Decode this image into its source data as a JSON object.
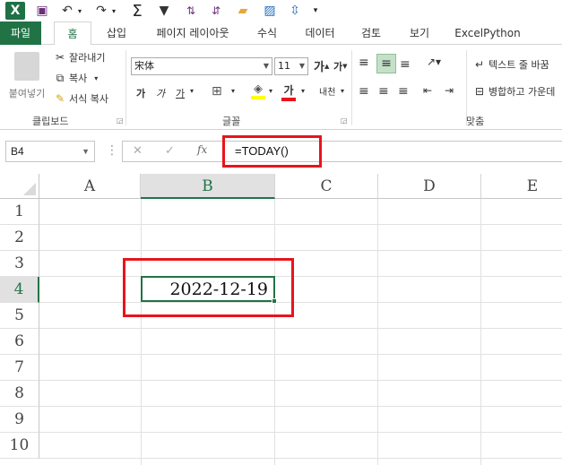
{
  "qat": {
    "logo": "X",
    "save_icon": "save-icon",
    "undo_icon": "undo-icon",
    "redo_icon": "redo-icon",
    "sum_icon": "autosum-icon",
    "filter_icon": "filter-icon",
    "sort_asc_icon": "sort-asc-icon",
    "sort_desc_icon": "sort-desc-icon",
    "folder_icon": "folder-icon",
    "more_icon": "customize-icon"
  },
  "tabs": [
    "파일",
    "홈",
    "삽입",
    "페이지 레이아웃",
    "수식",
    "데이터",
    "검토",
    "보기",
    "ExcelPython"
  ],
  "ribbon": {
    "clipboard": {
      "paste": "붙여넣기",
      "cut": "잘라내기",
      "copy": "복사",
      "format_painter": "서식 복사",
      "label": "클립보드"
    },
    "font": {
      "name": "宋体",
      "size": "11",
      "grow": "가",
      "shrink": "가",
      "bold": "가",
      "italic": "가",
      "underline": "가",
      "font_color": "가",
      "phonetic": "내천",
      "label": "글꼴"
    },
    "alignment": {
      "wrap_text": "텍스트 줄 바꿈",
      "merge_center": "병합하고 가운데",
      "label": "맞춤"
    }
  },
  "formula_bar": {
    "name_box": "B4",
    "cancel": "✕",
    "enter": "✓",
    "fx": "fx",
    "formula": "=TODAY()"
  },
  "sheet": {
    "columns": [
      "A",
      "B",
      "C",
      "D",
      "E"
    ],
    "rows": [
      "1",
      "2",
      "3",
      "4",
      "5",
      "6",
      "7",
      "8",
      "9",
      "10"
    ],
    "b4_value": "2022-12-19"
  },
  "colors": {
    "accent": "#217346",
    "highlight_box": "#e8141c"
  }
}
